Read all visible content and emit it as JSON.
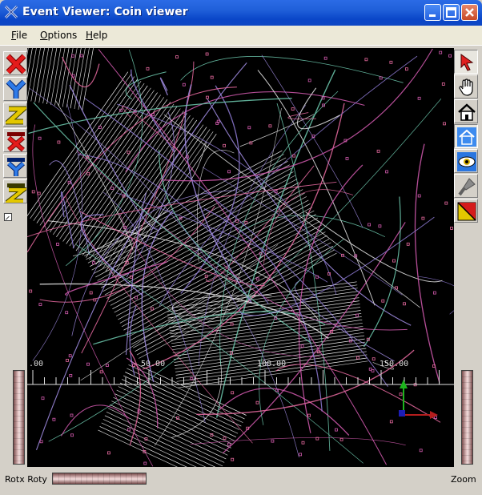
{
  "window": {
    "title": "Event Viewer: Coin viewer",
    "buttons": [
      "minimize",
      "maximize",
      "close"
    ]
  },
  "menu": [
    {
      "label": "File",
      "accel": "F",
      "rest": "ile"
    },
    {
      "label": "Options",
      "accel": "O",
      "rest": "ptions"
    },
    {
      "label": "Help",
      "accel": "H",
      "rest": "elp"
    }
  ],
  "left_toolbar": [
    {
      "name": "view-x-button",
      "icon": "x-axis-icon"
    },
    {
      "name": "view-y-button",
      "icon": "y-axis-icon"
    },
    {
      "name": "view-z-button",
      "icon": "z-axis-icon"
    },
    {
      "name": "view-minus-x-button",
      "icon": "minus-x-axis-icon"
    },
    {
      "name": "view-minus-y-button",
      "icon": "minus-y-axis-icon"
    },
    {
      "name": "view-minus-z-button",
      "icon": "minus-z-axis-icon"
    }
  ],
  "right_toolbar": [
    {
      "name": "select-button",
      "icon": "arrow-pointer-icon"
    },
    {
      "name": "pan-button",
      "icon": "hand-icon"
    },
    {
      "name": "home-button",
      "icon": "home-icon"
    },
    {
      "name": "set-home-button",
      "icon": "set-home-icon"
    },
    {
      "name": "view-all-button",
      "icon": "eye-icon"
    },
    {
      "name": "seek-button",
      "icon": "flashlight-icon"
    },
    {
      "name": "projection-button",
      "icon": "perspective-icon"
    }
  ],
  "viewport": {
    "axis_labels": [
      ".00",
      "50.00",
      "100.00",
      "150.00"
    ],
    "background": "#000000",
    "track_colors": [
      "#d45bb0",
      "#8f7bd6",
      "#e8e8e8",
      "#6fcbb0",
      "#e86aa0",
      "#a38ee6"
    ]
  },
  "status": {
    "rotx_roty_label": "Rotx Roty",
    "zoom_label": "Zoom"
  },
  "colors": {
    "titlebar": "#0a46c8",
    "menubar": "#ece9d8",
    "thumbwheel": "#e8c9c9"
  }
}
